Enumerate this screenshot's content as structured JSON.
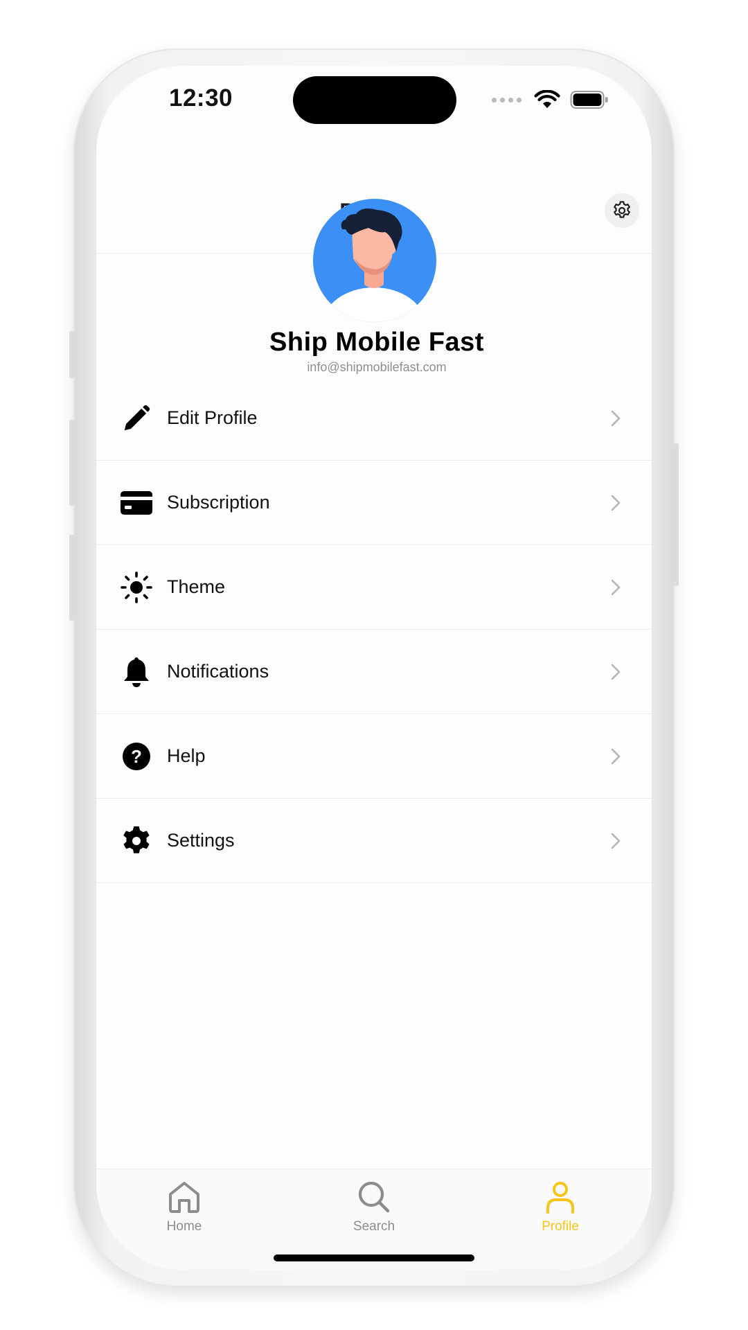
{
  "status_bar": {
    "time": "12:30"
  },
  "header": {
    "title": "Profile",
    "settings_icon": "gear-icon"
  },
  "profile": {
    "name": "Ship Mobile Fast",
    "email": "info@shipmobilefast.com",
    "avatar_icon": "user-avatar",
    "avatar_color": "#3b8ff5"
  },
  "menu": {
    "items": [
      {
        "label": "Edit Profile",
        "icon": "pencil-icon"
      },
      {
        "label": "Subscription",
        "icon": "credit-card-icon"
      },
      {
        "label": "Theme",
        "icon": "sun-icon"
      },
      {
        "label": "Notifications",
        "icon": "bell-icon"
      },
      {
        "label": "Help",
        "icon": "help-circle-icon"
      },
      {
        "label": "Settings",
        "icon": "gear-icon"
      }
    ]
  },
  "tabbar": {
    "tabs": [
      {
        "label": "Home",
        "icon": "home-icon",
        "active": false
      },
      {
        "label": "Search",
        "icon": "search-icon",
        "active": false
      },
      {
        "label": "Profile",
        "icon": "person-icon",
        "active": true
      }
    ],
    "active_color": "#f5c518",
    "inactive_color": "#8c8c8c"
  }
}
